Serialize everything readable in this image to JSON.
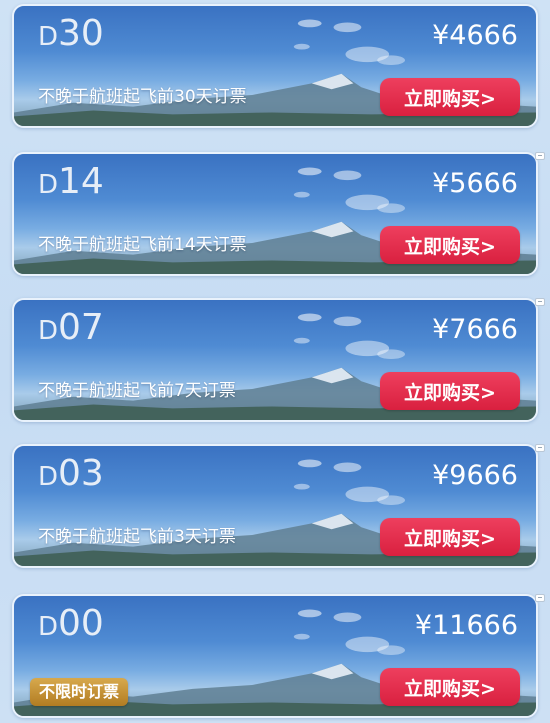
{
  "cards": [
    {
      "code_letter": "D",
      "code_num": "30",
      "price": "¥4666",
      "desc": "不晚于航班起飞前30天订票",
      "tag": "",
      "button": "立即购买>"
    },
    {
      "code_letter": "D",
      "code_num": "14",
      "price": "¥5666",
      "desc": "不晚于航班起飞前14天订票",
      "tag": "",
      "button": "立即购买>"
    },
    {
      "code_letter": "D",
      "code_num": "07",
      "price": "¥7666",
      "desc": "不晚于航班起飞前7天订票",
      "tag": "",
      "button": "立即购买>"
    },
    {
      "code_letter": "D",
      "code_num": "03",
      "price": "¥9666",
      "desc": "不晚于航班起飞前3天订票",
      "tag": "",
      "button": "立即购买>"
    },
    {
      "code_letter": "D",
      "code_num": "00",
      "price": "¥11666",
      "desc": "",
      "tag": "不限时订票",
      "button": "立即购买>"
    }
  ],
  "colors": {
    "button": "#e02e4c",
    "tag_gold": "#c4922f",
    "sky": "#4a86cf"
  }
}
